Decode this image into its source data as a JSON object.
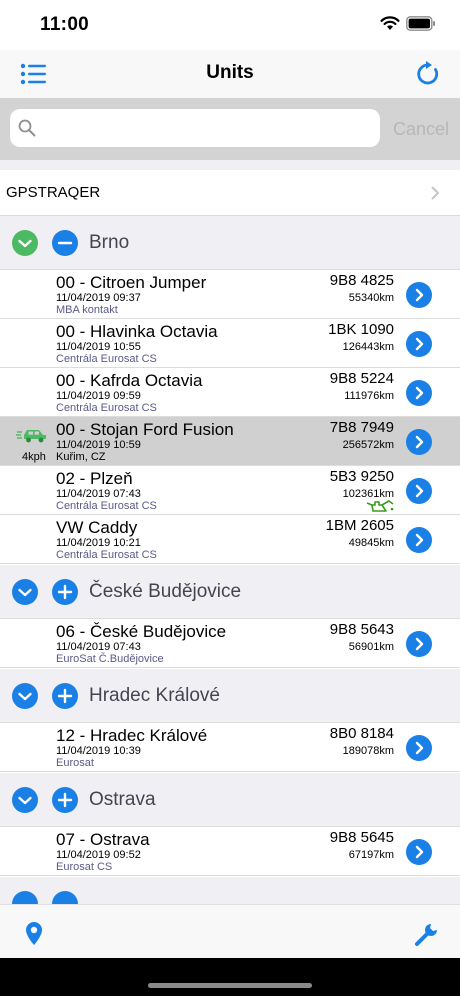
{
  "status_bar": {
    "time": "11:00"
  },
  "nav": {
    "title": "Units"
  },
  "search": {
    "placeholder": "",
    "cancel_label": "Cancel"
  },
  "account": {
    "label": "GPSTRAQER"
  },
  "colors": {
    "accent": "#1a80e6",
    "expanded_check": "#4cb963",
    "oil_warning": "#3a9a1a"
  },
  "groups": [
    {
      "name": "Brno",
      "state_icon": "checkmark-icon",
      "toggle_icon": "minus-icon",
      "units": [
        {
          "name": "00 - Citroen Jumper",
          "date": "11/04/2019 09:37",
          "location": "MBA kontakt",
          "plate": "9B8 4825",
          "km": "55340km"
        },
        {
          "name": "00 - Hlavinka Octavia",
          "date": "11/04/2019 10:55",
          "location": "Centrála Eurosat CS",
          "plate": "1BK 1090",
          "km": "126443km"
        },
        {
          "name": "00 - Kafrda Octavia",
          "date": "11/04/2019 09:59",
          "location": "Centrála Eurosat CS",
          "plate": "9B8 5224",
          "km": "111976km"
        },
        {
          "name": "00 - Stojan Ford Fusion",
          "date": "11/04/2019 10:59",
          "location": "Kuřim, CZ",
          "plate": "7B8 7949",
          "km": "256572km",
          "speed": "4kph",
          "moving": true
        },
        {
          "name": "02 - Plzeň",
          "date": "11/04/2019 07:43",
          "location": "Centrála Eurosat CS",
          "plate": "5B3 9250",
          "km": "102361km",
          "warning": "oil-can-icon"
        },
        {
          "name": "VW Caddy",
          "date": "11/04/2019 10:21",
          "location": "Centrála Eurosat CS",
          "plate": "1BM 2605",
          "km": "49845km"
        }
      ]
    },
    {
      "name": "České Budějovice",
      "state_icon": "chevron-down-icon",
      "toggle_icon": "plus-icon",
      "units": [
        {
          "name": "06 - České Budějovice",
          "date": "11/04/2019 07:43",
          "location": "EuroSat Č.Budějovice",
          "plate": "9B8 5643",
          "km": "56901km"
        }
      ]
    },
    {
      "name": "Hradec Králové",
      "state_icon": "chevron-down-icon",
      "toggle_icon": "plus-icon",
      "units": [
        {
          "name": "12 - Hradec Králové",
          "date": "11/04/2019 10:39",
          "location": "Eurosat",
          "plate": "8B0 8184",
          "km": "189078km"
        }
      ]
    },
    {
      "name": "Ostrava",
      "state_icon": "chevron-down-icon",
      "toggle_icon": "plus-icon",
      "units": [
        {
          "name": "07 - Ostrava",
          "date": "11/04/2019 09:52",
          "location": "Eurosat CS",
          "plate": "9B8 5645",
          "km": "67197km"
        }
      ]
    }
  ],
  "tabbar": {
    "left_icon": "location-pin-icon",
    "right_icon": "wrench-icon"
  }
}
